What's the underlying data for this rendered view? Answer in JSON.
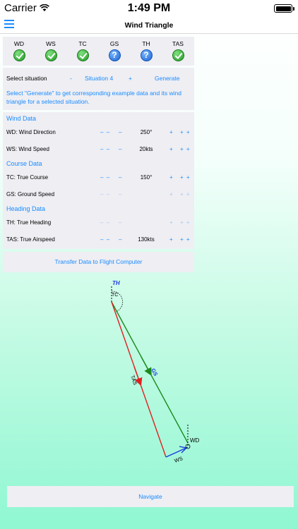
{
  "status_bar": {
    "carrier": "Carrier",
    "time": "1:49 PM"
  },
  "nav": {
    "title": "Wind Triangle"
  },
  "status_items": [
    {
      "label": "WD",
      "state": "check"
    },
    {
      "label": "WS",
      "state": "check"
    },
    {
      "label": "TC",
      "state": "check"
    },
    {
      "label": "GS",
      "state": "question"
    },
    {
      "label": "TH",
      "state": "question"
    },
    {
      "label": "TAS",
      "state": "check"
    }
  ],
  "situation": {
    "label": "Select situation",
    "minus": "-",
    "value": "Situation 4",
    "plus": "+",
    "generate": "Generate",
    "description": "Select \"Generate\" to get corresponding example data and its wind triangle for a selected situation."
  },
  "sections": {
    "wind": "Wind Data",
    "course": "Course Data",
    "heading": "Heading Data"
  },
  "rows": {
    "wd": {
      "name": "WD: Wind Direction",
      "value": "250°"
    },
    "ws": {
      "name": "WS: Wind Speed",
      "value": "20kts"
    },
    "tc": {
      "name": "TC: True Course",
      "value": "150°"
    },
    "gs": {
      "name": "GS: Ground Speed",
      "value": ""
    },
    "th": {
      "name": "TH: True Heading",
      "value": ""
    },
    "tas": {
      "name": "TAS: True Airspeed",
      "value": "130kts"
    }
  },
  "stepper": {
    "dec_big": "– –",
    "dec": "–",
    "inc": "+",
    "inc_big": "+ +"
  },
  "transfer_button": "Transfer Data to Flight Computer",
  "diagram": {
    "labels": {
      "th": "TH",
      "tc": "TC",
      "gs": "GS",
      "tas": "TAS",
      "wd": "WD",
      "ws": "WS"
    },
    "colors": {
      "gs": "#1a8a1a",
      "tas": "#e02020",
      "ws": "#1a3adf",
      "text": "#000000"
    }
  },
  "navigate_button": "Navigate"
}
